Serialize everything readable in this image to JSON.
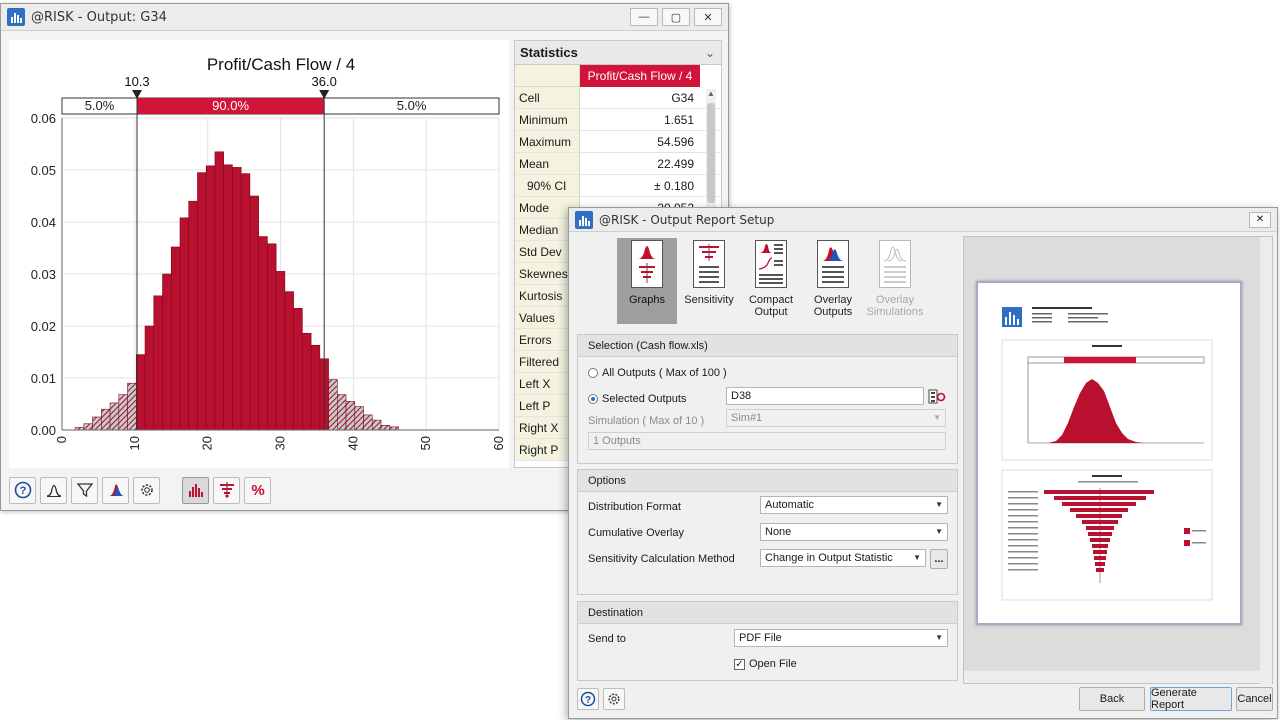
{
  "output_window": {
    "title": "@RISK - Output: G34",
    "buttons": {
      "minimize": "—",
      "maximize": "▢",
      "close": "✕"
    }
  },
  "chart_data": {
    "type": "bar",
    "title": "Profit/Cash Flow / 4",
    "xlabel": "",
    "ylabel": "",
    "xlim": [
      0,
      60
    ],
    "ylim": [
      0,
      0.06
    ],
    "x_ticks": [
      "0",
      "10",
      "20",
      "30",
      "40",
      "50",
      "60"
    ],
    "y_ticks": [
      "0.00",
      "0.01",
      "0.02",
      "0.03",
      "0.04",
      "0.05",
      "0.06"
    ],
    "bin_width": 1.2,
    "bin_start": 1.8,
    "values": [
      0.0005,
      0.0012,
      0.0025,
      0.004,
      0.0052,
      0.0068,
      0.009,
      0.0145,
      0.02,
      0.0258,
      0.03,
      0.0352,
      0.0408,
      0.044,
      0.0495,
      0.0508,
      0.0535,
      0.051,
      0.0505,
      0.0493,
      0.045,
      0.0372,
      0.0358,
      0.0305,
      0.0266,
      0.0234,
      0.0186,
      0.0163,
      0.0137,
      0.0097,
      0.0068,
      0.0055,
      0.0045,
      0.0029,
      0.0019,
      0.0009,
      0.0006
    ],
    "delimiters": {
      "left": 10.3,
      "right": 36.0,
      "left_label": "10.3",
      "right_label": "36.0"
    },
    "band": {
      "left_pct": "5.0%",
      "mid_pct": "90.0%",
      "right_pct": "5.0%"
    },
    "colors": {
      "bar": "#b8102e",
      "bar_edge": "#7a0a1e",
      "band_mid": "#d2143a"
    }
  },
  "statistics": {
    "header": "Statistics",
    "column": "Profit/Cash Flow / 4",
    "rows": [
      {
        "label": "Cell",
        "value": "G34"
      },
      {
        "label": "Minimum",
        "value": "1.651"
      },
      {
        "label": "Maximum",
        "value": "54.596"
      },
      {
        "label": "Mean",
        "value": "22.499"
      },
      {
        "label": "90% CI",
        "value": "± 0.180"
      },
      {
        "label": "Mode",
        "value": "20.952"
      },
      {
        "label": "Median",
        "value": ""
      },
      {
        "label": "Std Dev",
        "value": ""
      },
      {
        "label": "Skewness",
        "value": ""
      },
      {
        "label": "Kurtosis",
        "value": ""
      },
      {
        "label": "Values",
        "value": ""
      },
      {
        "label": "Errors",
        "value": ""
      },
      {
        "label": "Filtered",
        "value": ""
      },
      {
        "label": "Left X",
        "value": ""
      },
      {
        "label": "Left P",
        "value": ""
      },
      {
        "label": "Right X",
        "value": ""
      },
      {
        "label": "Right P",
        "value": ""
      }
    ]
  },
  "toolbar_icons": [
    "help-icon",
    "distribution-icon",
    "filter-icon",
    "overlay-icon",
    "settings-icon",
    "histogram-icon",
    "tornado-icon",
    "percent-icon"
  ],
  "report_window": {
    "title": "@RISK - Output Report Setup",
    "close": "✕",
    "report_types": [
      {
        "label": "Graphs"
      },
      {
        "label": "Sensitivity"
      },
      {
        "label": "Compact Output"
      },
      {
        "label": "Overlay Outputs"
      },
      {
        "label": "Overlay Simulations"
      }
    ],
    "selection": {
      "header": "Selection (Cash flow.xls)",
      "all_outputs": "All Outputs ( Max of 100 )",
      "selected_outputs": "Selected Outputs",
      "selected_value": "D38",
      "simulation_label": "Simulation ( Max of 10 )",
      "simulation_value": "Sim#1",
      "outputs_count": "1 Outputs"
    },
    "options": {
      "header": "Options",
      "distribution_format_label": "Distribution Format",
      "distribution_format_value": "Automatic",
      "cumulative_overlay_label": "Cumulative Overlay",
      "cumulative_overlay_value": "None",
      "sensitivity_method_label": "Sensitivity Calculation Method",
      "sensitivity_method_value": "Change in Output Statistic",
      "more_button": "..."
    },
    "destination": {
      "header": "Destination",
      "send_to_label": "Send to",
      "send_to_value": "PDF File",
      "open_file": "Open File",
      "open_file_checked": "✓"
    },
    "buttons": {
      "back": "Back",
      "generate": "Generate Report",
      "cancel": "Cancel"
    }
  }
}
